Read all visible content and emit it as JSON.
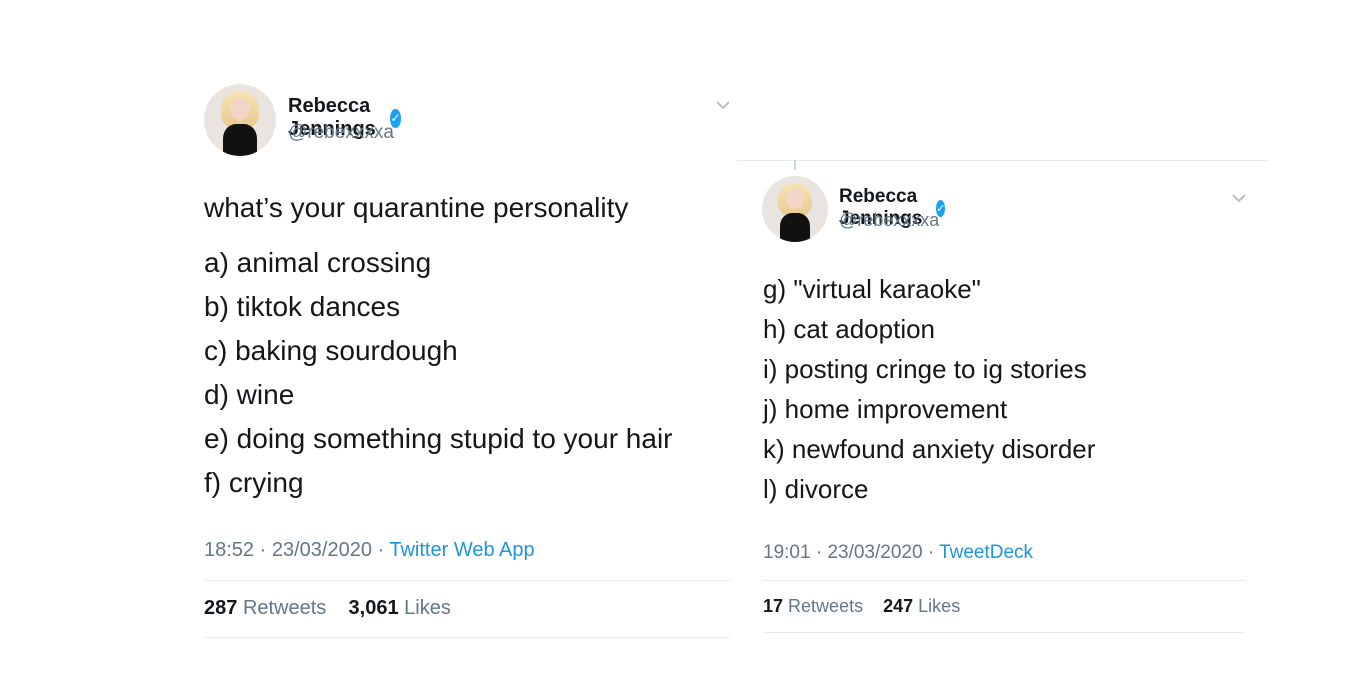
{
  "tweets": [
    {
      "author": {
        "name": "Rebecca Jennings",
        "handle": "@rebexxxxa"
      },
      "lines": [
        "what’s your quarantine personality",
        "a) animal crossing",
        "b) tiktok dances",
        "c) baking sourdough",
        "d) wine",
        "e) doing something stupid to your hair",
        "f) crying"
      ],
      "time": "18:52",
      "date": "23/03/2020",
      "source": "Twitter Web App",
      "retweets": "287",
      "retweets_label": "Retweets",
      "likes": "3,061",
      "likes_label": "Likes"
    },
    {
      "author": {
        "name": "Rebecca Jennings",
        "handle": "@rebexxxxa"
      },
      "lines": [
        "g) \"virtual karaoke\"",
        "h) cat adoption",
        "i) posting cringe to ig stories",
        "j) home improvement",
        "k) newfound anxiety disorder",
        "l) divorce"
      ],
      "time": "19:01",
      "date": "23/03/2020",
      "source": "TweetDeck",
      "retweets": "17",
      "retweets_label": "Retweets",
      "likes": "247",
      "likes_label": "Likes"
    }
  ],
  "icons": {
    "verified": "verified-badge-icon",
    "menu": "chevron-down-icon"
  },
  "colors": {
    "verified": "#1da1f2",
    "link": "#1b95e0",
    "muted": "#657786",
    "divider": "#e6ecf0"
  }
}
